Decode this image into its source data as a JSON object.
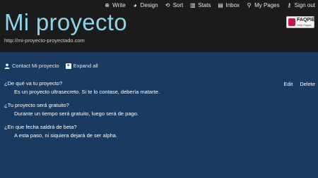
{
  "nav": [
    {
      "label": "Write",
      "icon": "plus-circle-icon",
      "glyph": "⊕"
    },
    {
      "label": "Design",
      "icon": "palette-icon",
      "glyph": "◕"
    },
    {
      "label": "Sort",
      "icon": "refresh-icon",
      "glyph": "⟲"
    },
    {
      "label": "Stats",
      "icon": "chart-icon",
      "glyph": "▥"
    },
    {
      "label": "Inbox",
      "icon": "inbox-icon",
      "glyph": "▤"
    },
    {
      "label": "My Pages",
      "icon": "search-icon",
      "glyph": "⚲"
    },
    {
      "label": "Sign out",
      "icon": "lock-icon",
      "glyph": "⚷"
    }
  ],
  "site": {
    "title": "Mi proyecto",
    "url": "http://mi-proyecto-proyectado.com"
  },
  "logo": {
    "brand": "FAQPIE",
    "sub": "Help Pages"
  },
  "toolbar": {
    "contact_label": "Contact Mi proyecto",
    "expand_label": "Expand all"
  },
  "item_actions": {
    "edit": "Edit",
    "delete": "Delete"
  },
  "faqs": [
    {
      "q": "¿De qué va tu proyecto?",
      "a": "Es un proyecto ultrasecreto. Si te lo contase, debería matarte."
    },
    {
      "q": "¿Tu proyecto será gratuito?",
      "a": "Durante un tiempo será gratuito, luego será de pago."
    },
    {
      "q": "¿En que fecha saldrá de beta?",
      "a": "A esta paso, ni siquiera dejará de ser alpha."
    }
  ],
  "colors": {
    "header_bg": "#1b1b1b",
    "body_bg": "#1b3a5f",
    "title": "#8fd3ea",
    "logo_accent": "#c2185b"
  }
}
